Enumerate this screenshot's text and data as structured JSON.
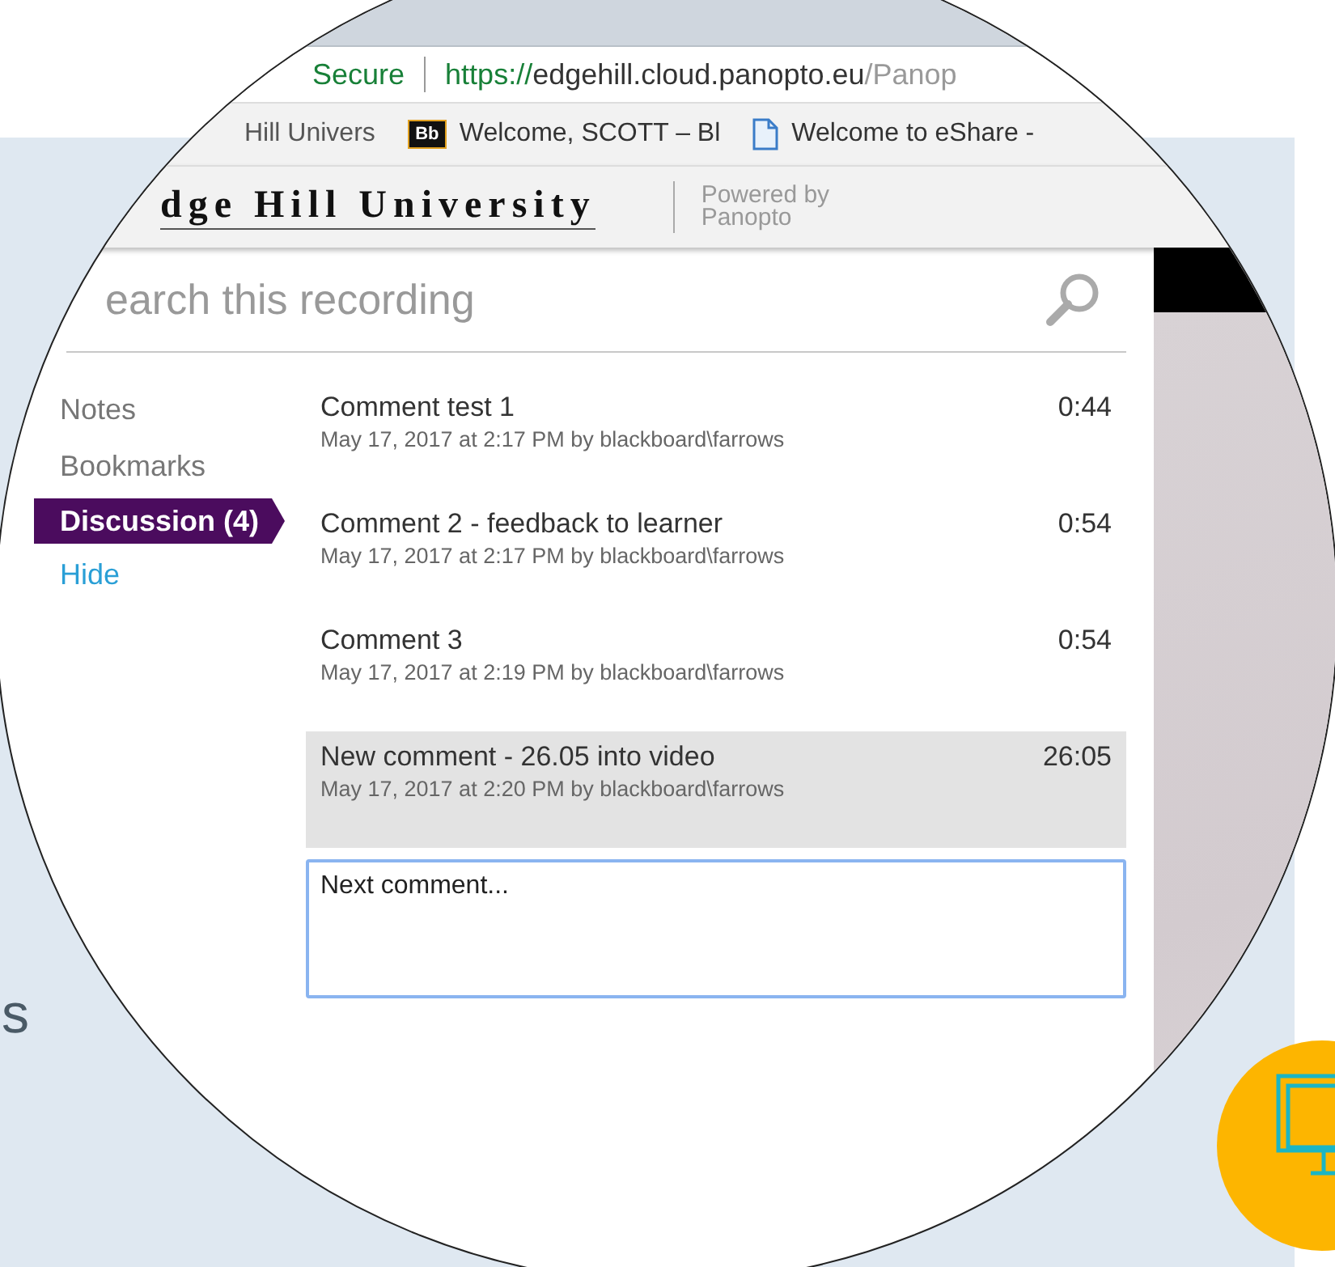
{
  "page": {
    "side_text": "s"
  },
  "browser": {
    "security_label": "Secure",
    "url": {
      "scheme": "https://",
      "host": "edgehill.cloud.panopto.eu",
      "path": "/Panop"
    }
  },
  "bookmarks": [
    {
      "label": "Hill Univers",
      "kind": "plain"
    },
    {
      "label": "Welcome, SCOTT – Bl",
      "kind": "blackboard",
      "icon_text": "Bb"
    },
    {
      "label": "Welcome to eShare -",
      "kind": "document"
    }
  ],
  "header": {
    "brand": "dge Hill University",
    "powered_by": [
      "Powered by",
      "Panopto"
    ]
  },
  "search": {
    "placeholder": "earch this recording"
  },
  "tabs": [
    {
      "label": "Notes",
      "selected": false
    },
    {
      "label": "Bookmarks",
      "selected": false
    },
    {
      "label": "Discussion (4)",
      "selected": true
    }
  ],
  "hide_link": "Hide",
  "comments": [
    {
      "title": "Comment test 1",
      "meta": "May 17, 2017 at 2:17 PM by blackboard\\farrows",
      "time": "0:44",
      "selected": false
    },
    {
      "title": "Comment 2 - feedback to learner",
      "meta": "May 17, 2017 at 2:17 PM by blackboard\\farrows",
      "time": "0:54",
      "selected": false
    },
    {
      "title": "Comment 3",
      "meta": "May 17, 2017 at 2:19 PM by blackboard\\farrows",
      "time": "0:54",
      "selected": false
    },
    {
      "title": "New comment - 26.05 into video",
      "meta": "May 17, 2017 at 2:20 PM by blackboard\\farrows",
      "time": "26:05",
      "selected": true
    }
  ],
  "comment_box": {
    "value": "Next comment..."
  }
}
